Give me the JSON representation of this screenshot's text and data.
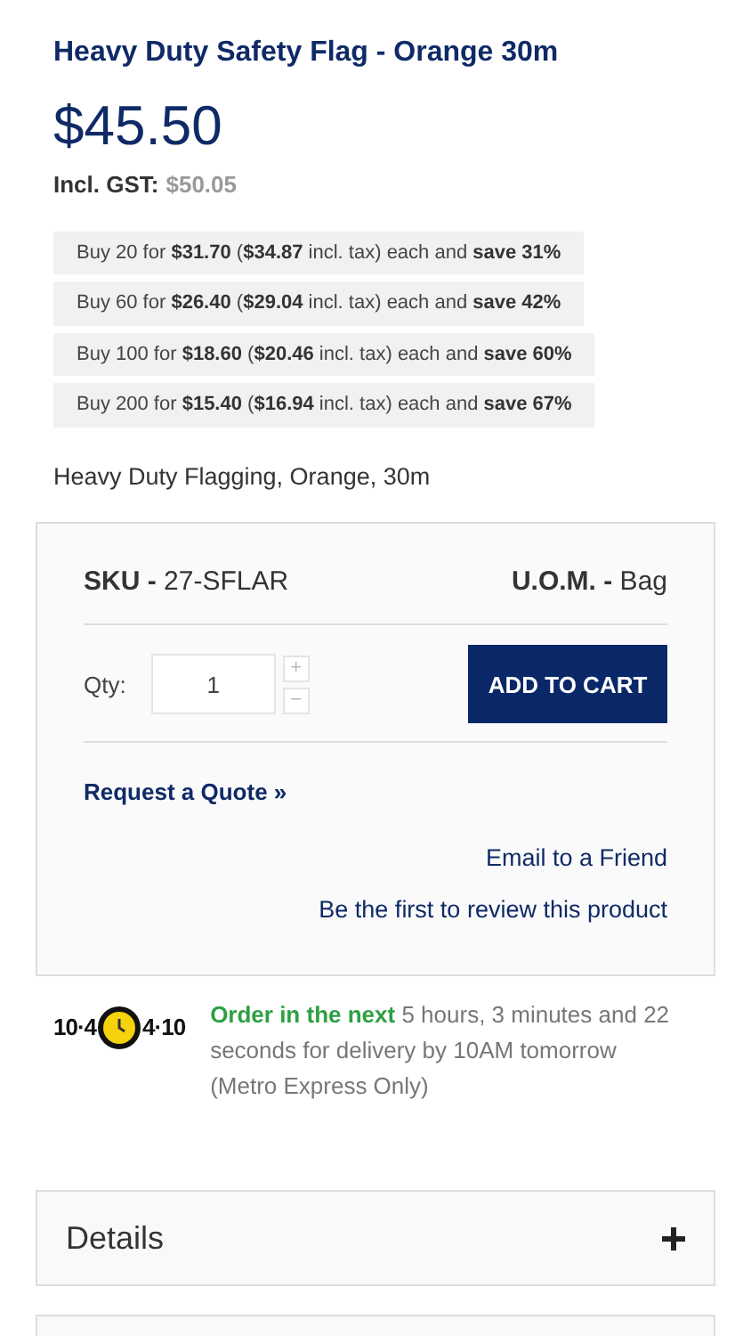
{
  "product": {
    "title": "Heavy Duty Safety Flag - Orange 30m",
    "price": "$45.50",
    "gst_label": "Incl. GST:",
    "gst_price": "$50.05"
  },
  "tiers": [
    {
      "text": "Buy 20 for **$31.70** (**$34.87** incl. tax) each and **save 31%**"
    },
    {
      "text": "Buy 60 for **$26.40** (**$29.04** incl. tax) each and **save 42%**"
    },
    {
      "text": "Buy 100 for **$18.60** (**$20.46** incl. tax) each and **save 60%**"
    },
    {
      "text": "Buy 200 for **$15.40** (**$16.94** incl. tax) each and **save 67%**"
    }
  ],
  "description": "Heavy Duty Flagging, Orange, 30m",
  "purchase_box": {
    "sku_label": "SKU -",
    "sku": "27-SFLAR",
    "uom_label": "U.O.M. -",
    "uom": "Bag",
    "qty_label": "Qty:",
    "qty": "1",
    "plus": "+",
    "minus": "−",
    "add_to_cart": "ADD TO CART",
    "quote": "Request a Quote",
    "quote_arrow": "»",
    "links": [
      "Email to a Friend",
      "Be the first to review this product"
    ]
  },
  "delivery": {
    "logo_left": "10·4",
    "logo_right": "4·10",
    "highlight": "Order in the next",
    "text": "5 hours, 3 minutes and 22 seconds for delivery by 10AM tomorrow (Metro Express Only)"
  },
  "panels": [
    {
      "title": "Details",
      "expanded": false
    }
  ],
  "more_panels_below": true
}
